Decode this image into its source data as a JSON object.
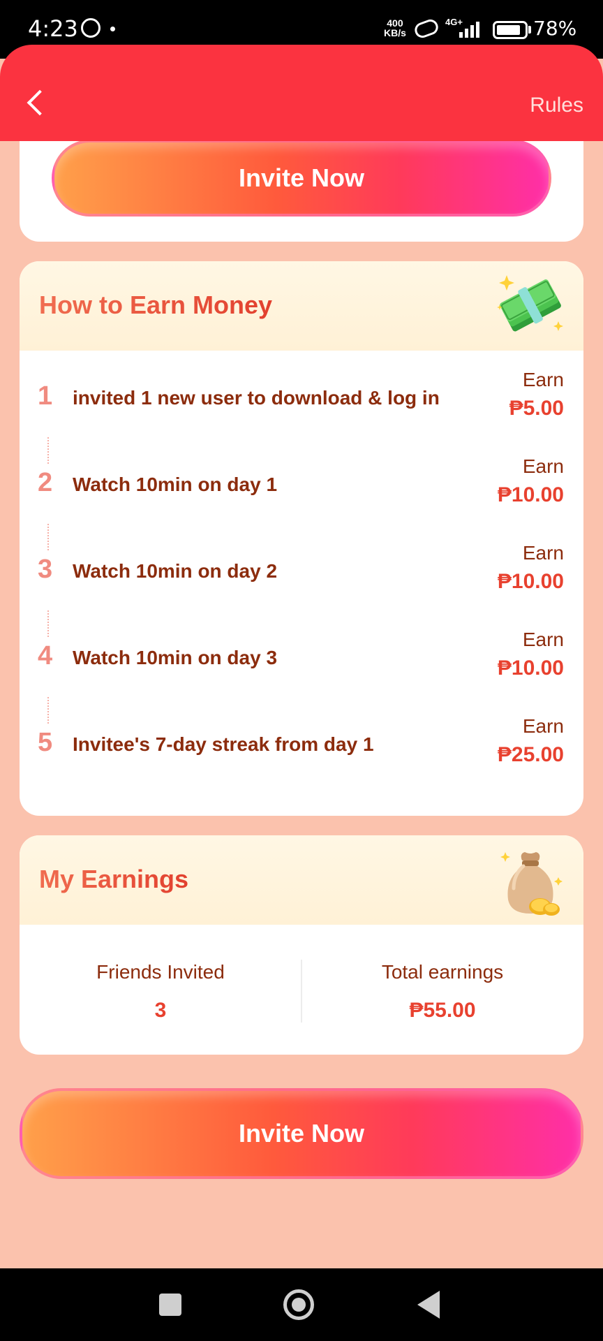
{
  "status_bar": {
    "time": "4:23",
    "speed_top": "400",
    "speed_bottom": "KB/s",
    "network": "4G+",
    "battery": "78%"
  },
  "header": {
    "rules_label": "Rules"
  },
  "top_card": {
    "invite_label": "Invite Now"
  },
  "earn_card": {
    "title": "How to Earn Money",
    "steps": [
      {
        "num": "1",
        "text": "invited 1 new user to download & log in",
        "earn_label": "Earn",
        "amount": "₱5.00"
      },
      {
        "num": "2",
        "text": "Watch 10min on day 1",
        "earn_label": "Earn",
        "amount": "₱10.00"
      },
      {
        "num": "3",
        "text": "Watch 10min on day 2",
        "earn_label": "Earn",
        "amount": "₱10.00"
      },
      {
        "num": "4",
        "text": "Watch 10min on day 3",
        "earn_label": "Earn",
        "amount": "₱10.00"
      },
      {
        "num": "5",
        "text": "Invitee's 7-day streak from day 1",
        "earn_label": "Earn",
        "amount": "₱25.00"
      }
    ]
  },
  "earnings_card": {
    "title": "My Earnings",
    "friends_label": "Friends Invited",
    "friends_value": "3",
    "total_label": "Total earnings",
    "total_value": "₱55.00"
  },
  "bottom": {
    "invite_label": "Invite Now"
  },
  "colors": {
    "header": "#fb3340",
    "page_bg": "#fbc2ad",
    "accent": "#e8412f"
  }
}
